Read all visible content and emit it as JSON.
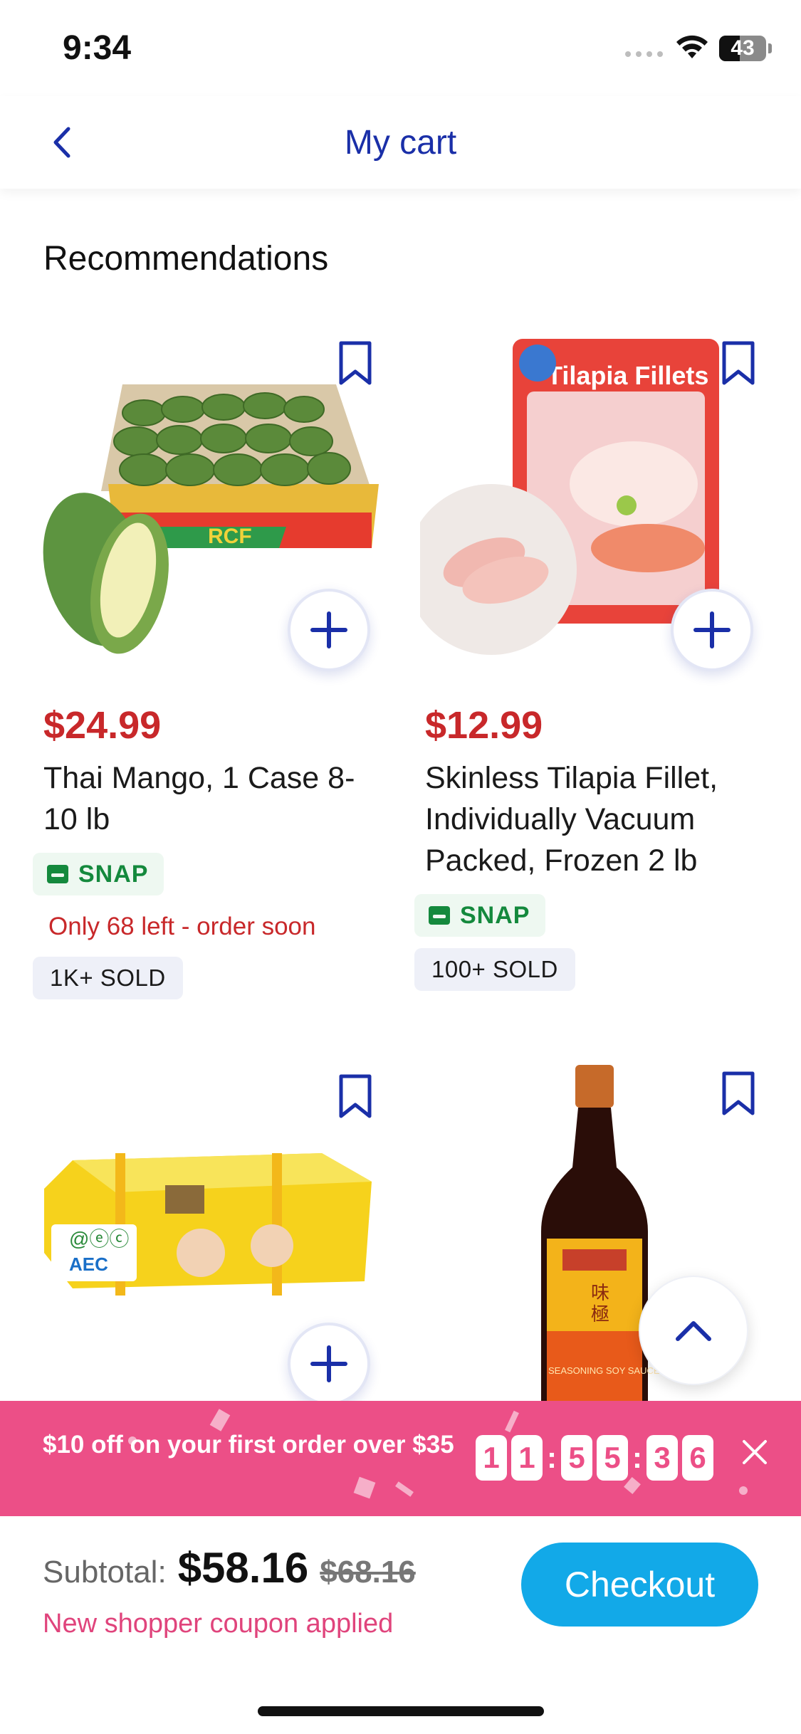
{
  "status_bar": {
    "time": "9:34",
    "battery": "43"
  },
  "header": {
    "title": "My cart",
    "back_icon": "chevron-left-icon"
  },
  "section": {
    "title": "Recommendations"
  },
  "products": [
    {
      "price": "$24.99",
      "name": "Thai Mango, 1 Case 8-10 lb",
      "snap": "SNAP",
      "stock_note": "Only 68 left - order soon",
      "sold": "1K+ SOLD"
    },
    {
      "price": "$12.99",
      "name": "Skinless Tilapia Fillet, Individually Vacuum Packed, Frozen 2 lb",
      "snap": "SNAP",
      "sold": "100+ SOLD",
      "package_label": "Tilapia Fillets"
    },
    {
      "box_brand": "AEC"
    },
    {
      "bottle_label": "SEASONING SOY SAUCE"
    }
  ],
  "promo": {
    "text": "$10 off on your first order over $35",
    "timer_digits": [
      "1",
      "1",
      "5",
      "5",
      "3",
      "6"
    ]
  },
  "footer": {
    "subtotal_label": "Subtotal:",
    "subtotal": "$58.16",
    "original": "$68.16",
    "coupon_text": "New shopper coupon applied",
    "checkout_label": "Checkout"
  },
  "colors": {
    "brand_blue": "#1a2fa8",
    "price_red": "#c8282a",
    "snap_green": "#14893d",
    "promo_pink": "#ec4f87",
    "checkout_blue": "#12a9e8"
  }
}
